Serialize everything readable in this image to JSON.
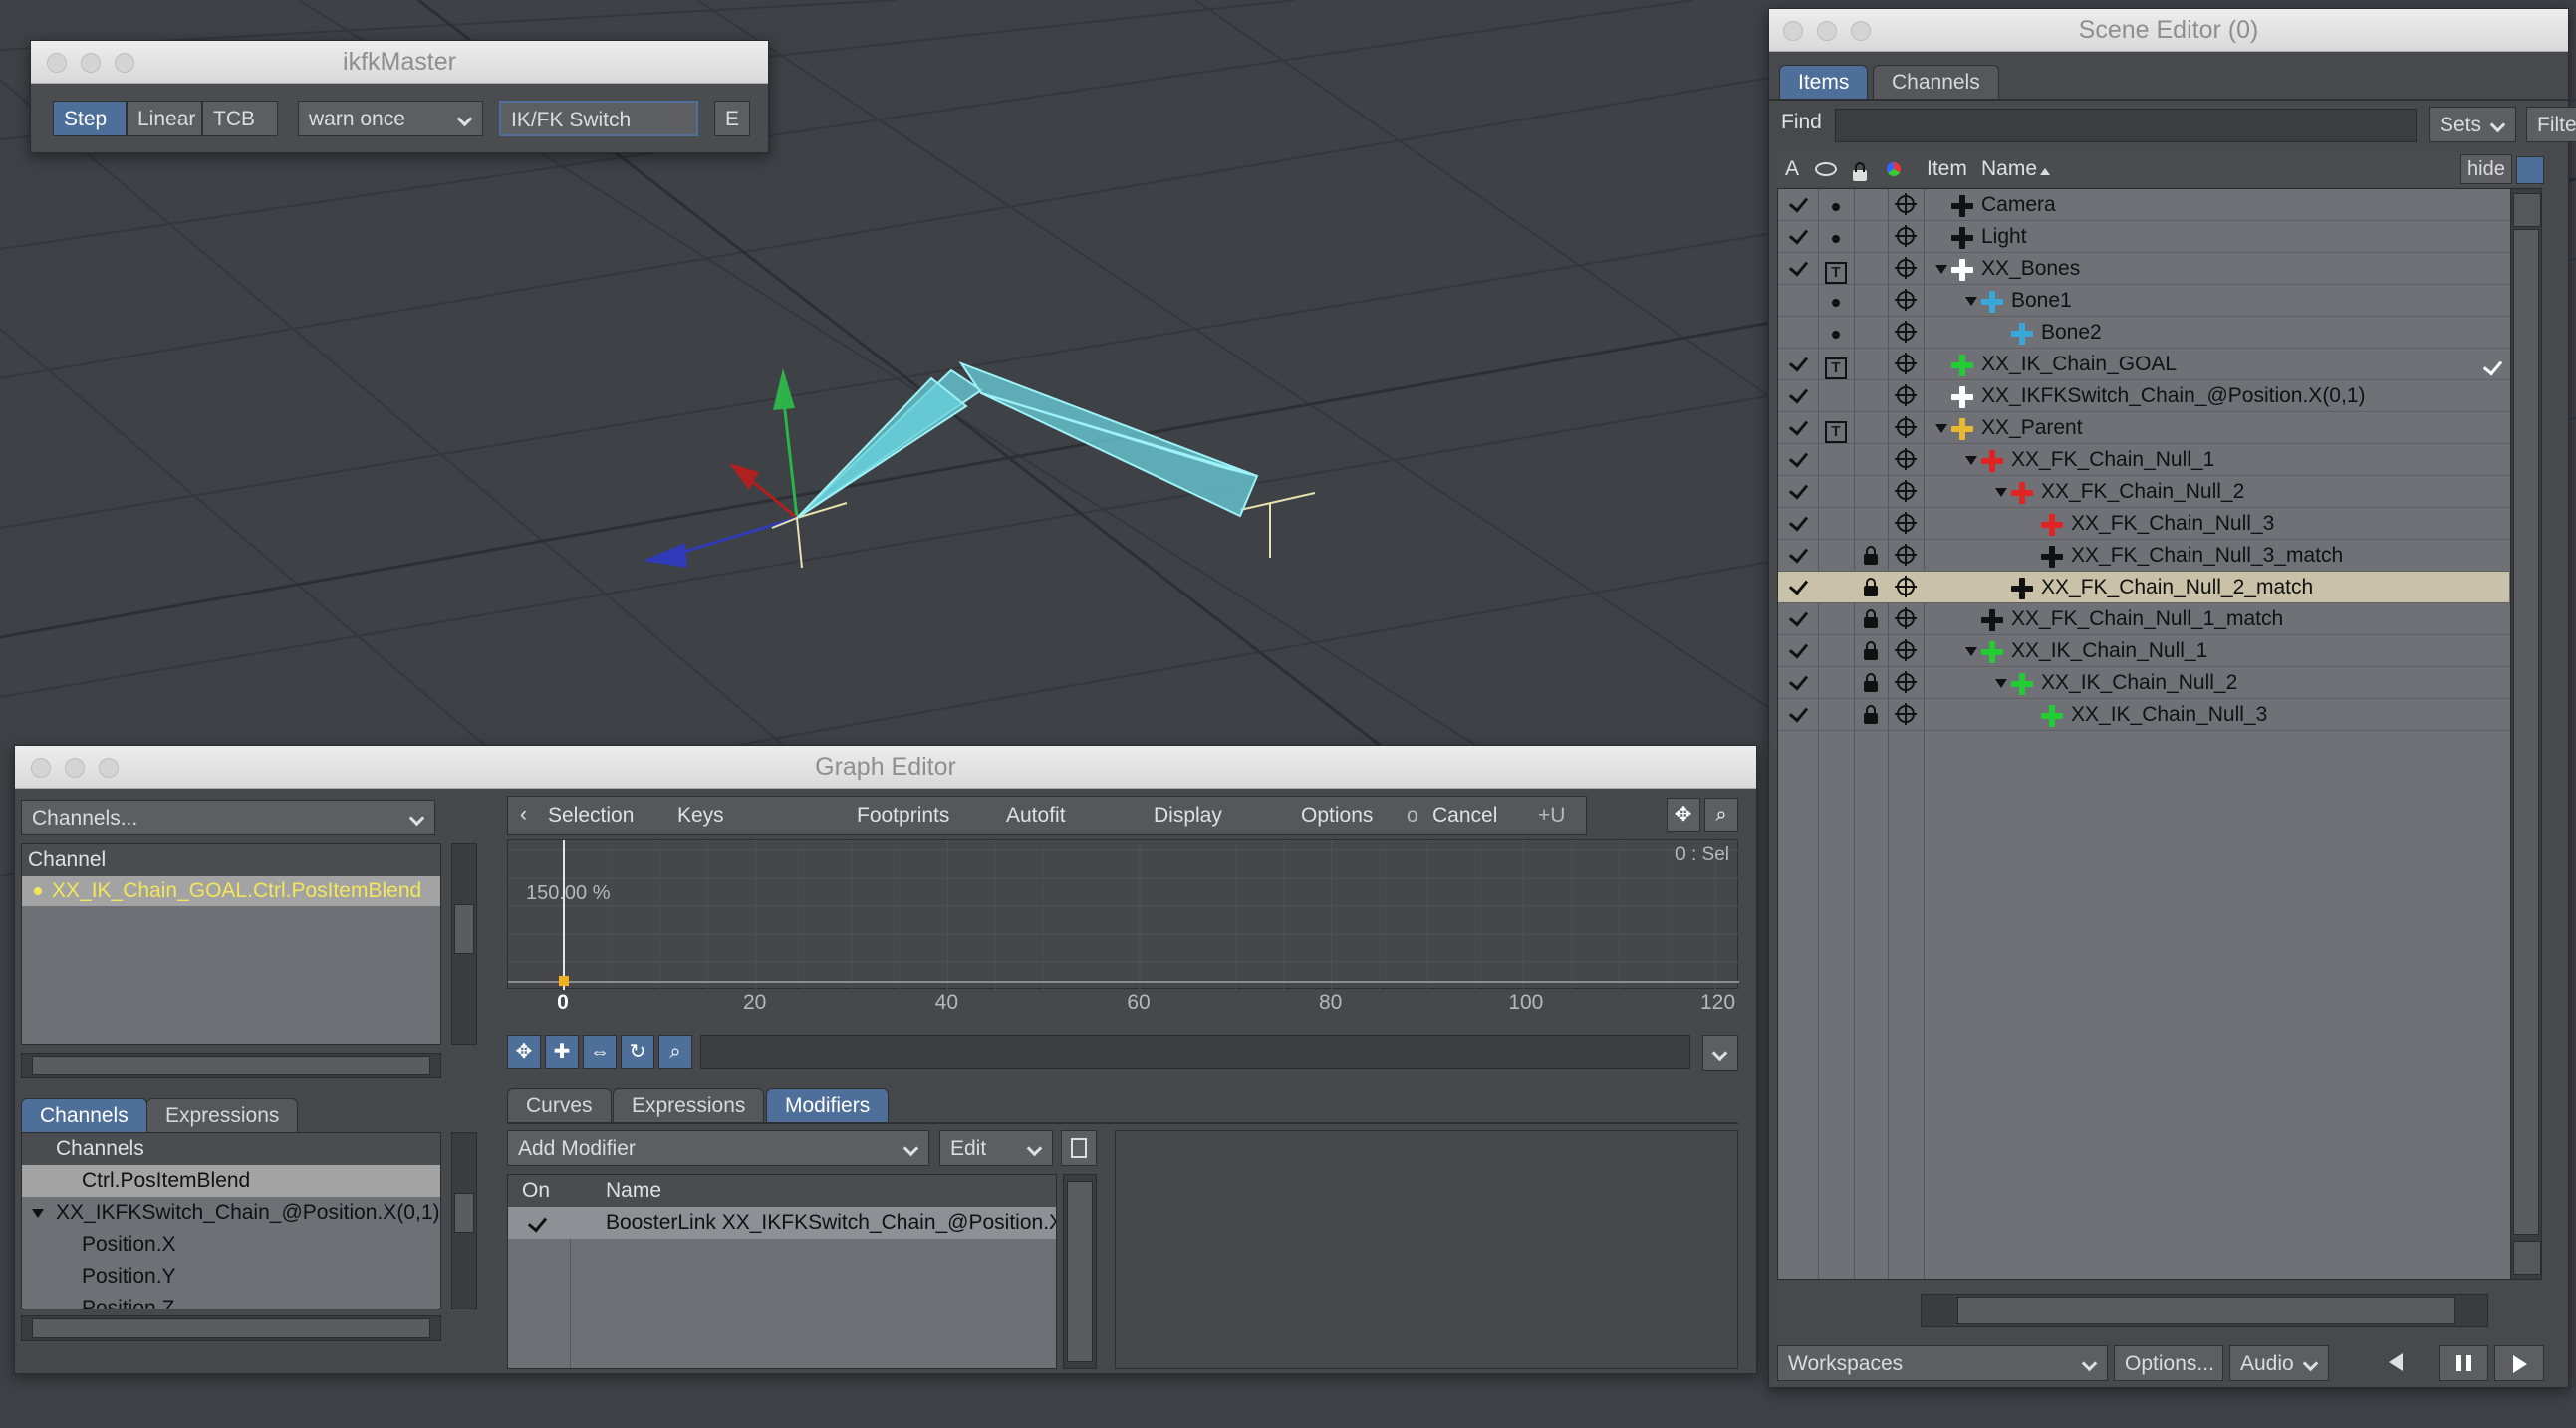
{
  "ikfk": {
    "title": "ikfkMaster",
    "step": "Step",
    "linear": "Linear",
    "tcb": "TCB",
    "warn": "warn once",
    "switch": "IK/FK Switch",
    "e": "E"
  },
  "scene_editor": {
    "title": "Scene Editor (0)",
    "tabs": [
      "Items",
      "Channels"
    ],
    "find_label": "Find",
    "find_value": "",
    "sets": "Sets",
    "filter": "Filter",
    "headers": {
      "a": "A",
      "item": "Item",
      "name": "Name"
    },
    "hide": "hide",
    "items": [
      {
        "name": "Camera",
        "check": true,
        "vis": "dot",
        "lock": false,
        "indent": 0,
        "expand": false,
        "icon": "camera-icon",
        "color": "#111111"
      },
      {
        "name": "Light",
        "check": true,
        "vis": "dot",
        "lock": false,
        "indent": 0,
        "expand": false,
        "icon": "light-icon",
        "color": "#111111"
      },
      {
        "name": "XX_Bones",
        "check": true,
        "vis": "box",
        "lock": false,
        "indent": 0,
        "expand": true,
        "icon": "null-icon",
        "color": "#ffffff"
      },
      {
        "name": "Bone1",
        "check": false,
        "vis": "dot",
        "lock": false,
        "indent": 1,
        "expand": true,
        "icon": "bone-icon",
        "color": "#3aa7d9"
      },
      {
        "name": "Bone2",
        "check": false,
        "vis": "dot",
        "lock": false,
        "indent": 2,
        "expand": false,
        "icon": "bone-icon",
        "color": "#3aa7d9"
      },
      {
        "name": "XX_IK_Chain_GOAL",
        "check": true,
        "vis": "box",
        "lock": false,
        "indent": 0,
        "expand": false,
        "icon": "null-icon",
        "color": "#22cc33",
        "tick": true
      },
      {
        "name": "XX_IKFKSwitch_Chain_@Position.X(0,1)",
        "check": true,
        "vis": "",
        "lock": false,
        "indent": 0,
        "expand": false,
        "icon": "null-icon",
        "color": "#ffffff"
      },
      {
        "name": "XX_Parent",
        "check": true,
        "vis": "box",
        "lock": false,
        "indent": 0,
        "expand": true,
        "icon": "null-icon",
        "color": "#e8b830"
      },
      {
        "name": "XX_FK_Chain_Null_1",
        "check": true,
        "vis": "",
        "lock": false,
        "indent": 1,
        "expand": true,
        "icon": "null-icon",
        "color": "#e02424"
      },
      {
        "name": "XX_FK_Chain_Null_2",
        "check": true,
        "vis": "",
        "lock": false,
        "indent": 2,
        "expand": true,
        "icon": "null-icon",
        "color": "#e02424"
      },
      {
        "name": "XX_FK_Chain_Null_3",
        "check": true,
        "vis": "",
        "lock": false,
        "indent": 3,
        "expand": false,
        "icon": "null-icon",
        "color": "#e02424"
      },
      {
        "name": "XX_FK_Chain_Null_3_match",
        "check": true,
        "vis": "",
        "lock": true,
        "indent": 3,
        "expand": false,
        "icon": "null-icon",
        "color": "#111111"
      },
      {
        "name": "XX_FK_Chain_Null_2_match",
        "check": true,
        "vis": "",
        "lock": true,
        "indent": 2,
        "expand": false,
        "icon": "null-icon",
        "color": "#111111",
        "selected": true
      },
      {
        "name": "XX_FK_Chain_Null_1_match",
        "check": true,
        "vis": "",
        "lock": true,
        "indent": 1,
        "expand": false,
        "icon": "null-icon",
        "color": "#111111"
      },
      {
        "name": "XX_IK_Chain_Null_1",
        "check": true,
        "vis": "",
        "lock": true,
        "indent": 1,
        "expand": true,
        "icon": "null-icon",
        "color": "#22cc33"
      },
      {
        "name": "XX_IK_Chain_Null_2",
        "check": true,
        "vis": "",
        "lock": true,
        "indent": 2,
        "expand": true,
        "icon": "null-icon",
        "color": "#22cc33"
      },
      {
        "name": "XX_IK_Chain_Null_3",
        "check": true,
        "vis": "",
        "lock": true,
        "indent": 3,
        "expand": false,
        "icon": "null-icon",
        "color": "#22cc33"
      }
    ],
    "bottom": {
      "workspaces": "Workspaces",
      "options": "Options...",
      "audio": "Audio"
    }
  },
  "graph_editor": {
    "title": "Graph Editor",
    "channels_dropdown": "Channels...",
    "channel_header": "Channel",
    "channel_item": "XX_IK_Chain_GOAL.Ctrl.PosItemBlend",
    "toolbar": {
      "selection": "Selection",
      "keys": "Keys",
      "footprints": "Footprints",
      "autofit": "Autofit",
      "display": "Display",
      "options": "Options",
      "o": "o",
      "cancel": "Cancel",
      "plus_u": "+U"
    },
    "graph": {
      "sel_label": "0 : Sel",
      "y_label": "150.00 %",
      "ticks": [
        "0",
        "20",
        "40",
        "60",
        "80",
        "100",
        "120"
      ]
    },
    "left_tabs": [
      "Channels",
      "Expressions"
    ],
    "tree_header": "Channels",
    "tree": [
      "Ctrl.PosItemBlend",
      "XX_IKFKSwitch_Chain_@Position.X(0,1)",
      "Position.X",
      "Position.Y",
      "Position.Z"
    ],
    "bottom_tabs": [
      "Curves",
      "Expressions",
      "Modifiers"
    ],
    "add_modifier": "Add Modifier",
    "edit": "Edit",
    "mod_headers": {
      "on": "On",
      "name": "Name"
    },
    "modifier": "BoosterLink XX_IKFKSwitch_Chain_@Position.X"
  }
}
